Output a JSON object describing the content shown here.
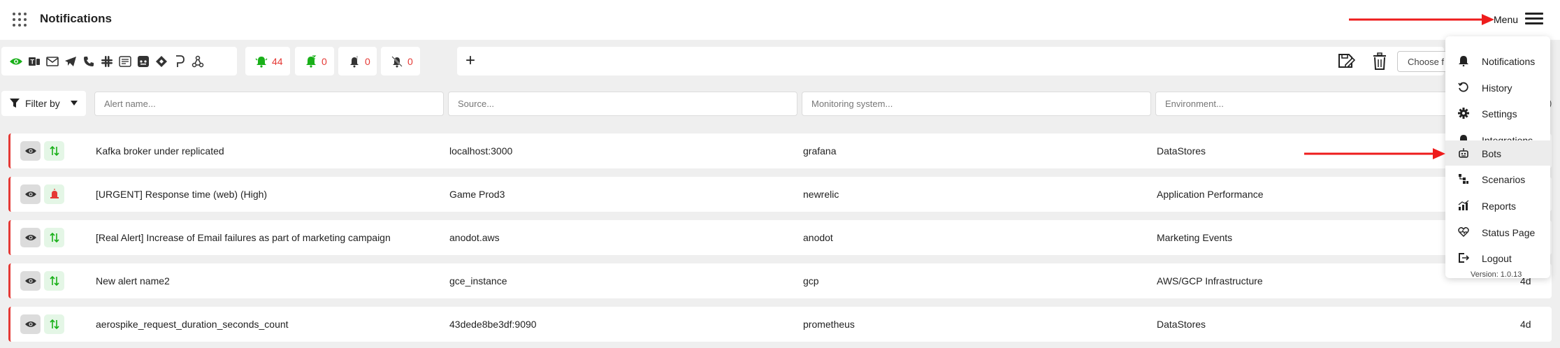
{
  "header": {
    "title": "Notifications",
    "menu_label": "Menu"
  },
  "channels": [
    "eye-icon",
    "teams-icon",
    "email-icon",
    "telegram-icon",
    "phone-icon",
    "slack-icon",
    "sms-icon",
    "discord-icon",
    "jira-icon",
    "pagerduty-icon",
    "webhook-icon"
  ],
  "counters": [
    {
      "icon": "bell-active-icon",
      "value": "44",
      "color": "#19b019"
    },
    {
      "icon": "bell-snoozed-icon",
      "value": "0",
      "color": "#19b019"
    },
    {
      "icon": "bell-acked-icon",
      "value": "0",
      "color": "#333333"
    },
    {
      "icon": "bell-muted-icon",
      "value": "0",
      "color": "#333333"
    }
  ],
  "toolbar": {
    "add_label": "+",
    "choose_placeholder": "Choose f"
  },
  "filters": {
    "filter_by_label": "Filter by",
    "alert_name_placeholder": "Alert name...",
    "source_placeholder": "Source...",
    "monitoring_placeholder": "Monitoring system...",
    "environment_placeholder": "Environment...",
    "tail": ")"
  },
  "alerts": [
    {
      "name": "Kafka broker under replicated",
      "source": "localhost:3000",
      "monitoring": "grafana",
      "environment": "DataStores",
      "age": "",
      "status": "resolved"
    },
    {
      "name": "[URGENT] Response time (web) (High)",
      "source": "Game Prod3",
      "monitoring": "newrelic",
      "environment": "Application Performance",
      "age": "",
      "status": "alerting"
    },
    {
      "name": "[Real Alert] Increase of Email failures as part of marketing campaign",
      "source": "anodot.aws",
      "monitoring": "anodot",
      "environment": "Marketing Events",
      "age": "",
      "status": "resolved"
    },
    {
      "name": "New alert name2",
      "source": "gce_instance",
      "monitoring": "gcp",
      "environment": "AWS/GCP Infrastructure",
      "age": "4d",
      "status": "resolved"
    },
    {
      "name": "aerospike_request_duration_seconds_count",
      "source": "43dede8be3df:9090",
      "monitoring": "prometheus",
      "environment": "DataStores",
      "age": "4d",
      "status": "resolved"
    }
  ],
  "menu": {
    "items": [
      {
        "label": "Notifications",
        "icon": "bell-icon"
      },
      {
        "label": "History",
        "icon": "history-icon"
      },
      {
        "label": "Settings",
        "icon": "gear-icon"
      },
      {
        "label": "Integrations",
        "icon": "bell-icon"
      },
      {
        "label": "Bots",
        "icon": "robot-icon"
      },
      {
        "label": "Scenarios",
        "icon": "scenarios-icon"
      },
      {
        "label": "Reports",
        "icon": "chart-icon"
      },
      {
        "label": "Status Page",
        "icon": "heartbeat-icon"
      },
      {
        "label": "Logout",
        "icon": "logout-icon"
      }
    ],
    "version": "Version: 1.0.13"
  },
  "colors": {
    "accent_green": "#19b019",
    "alert_red": "#e53935",
    "annotation_arrow": "#ee1c1c"
  }
}
